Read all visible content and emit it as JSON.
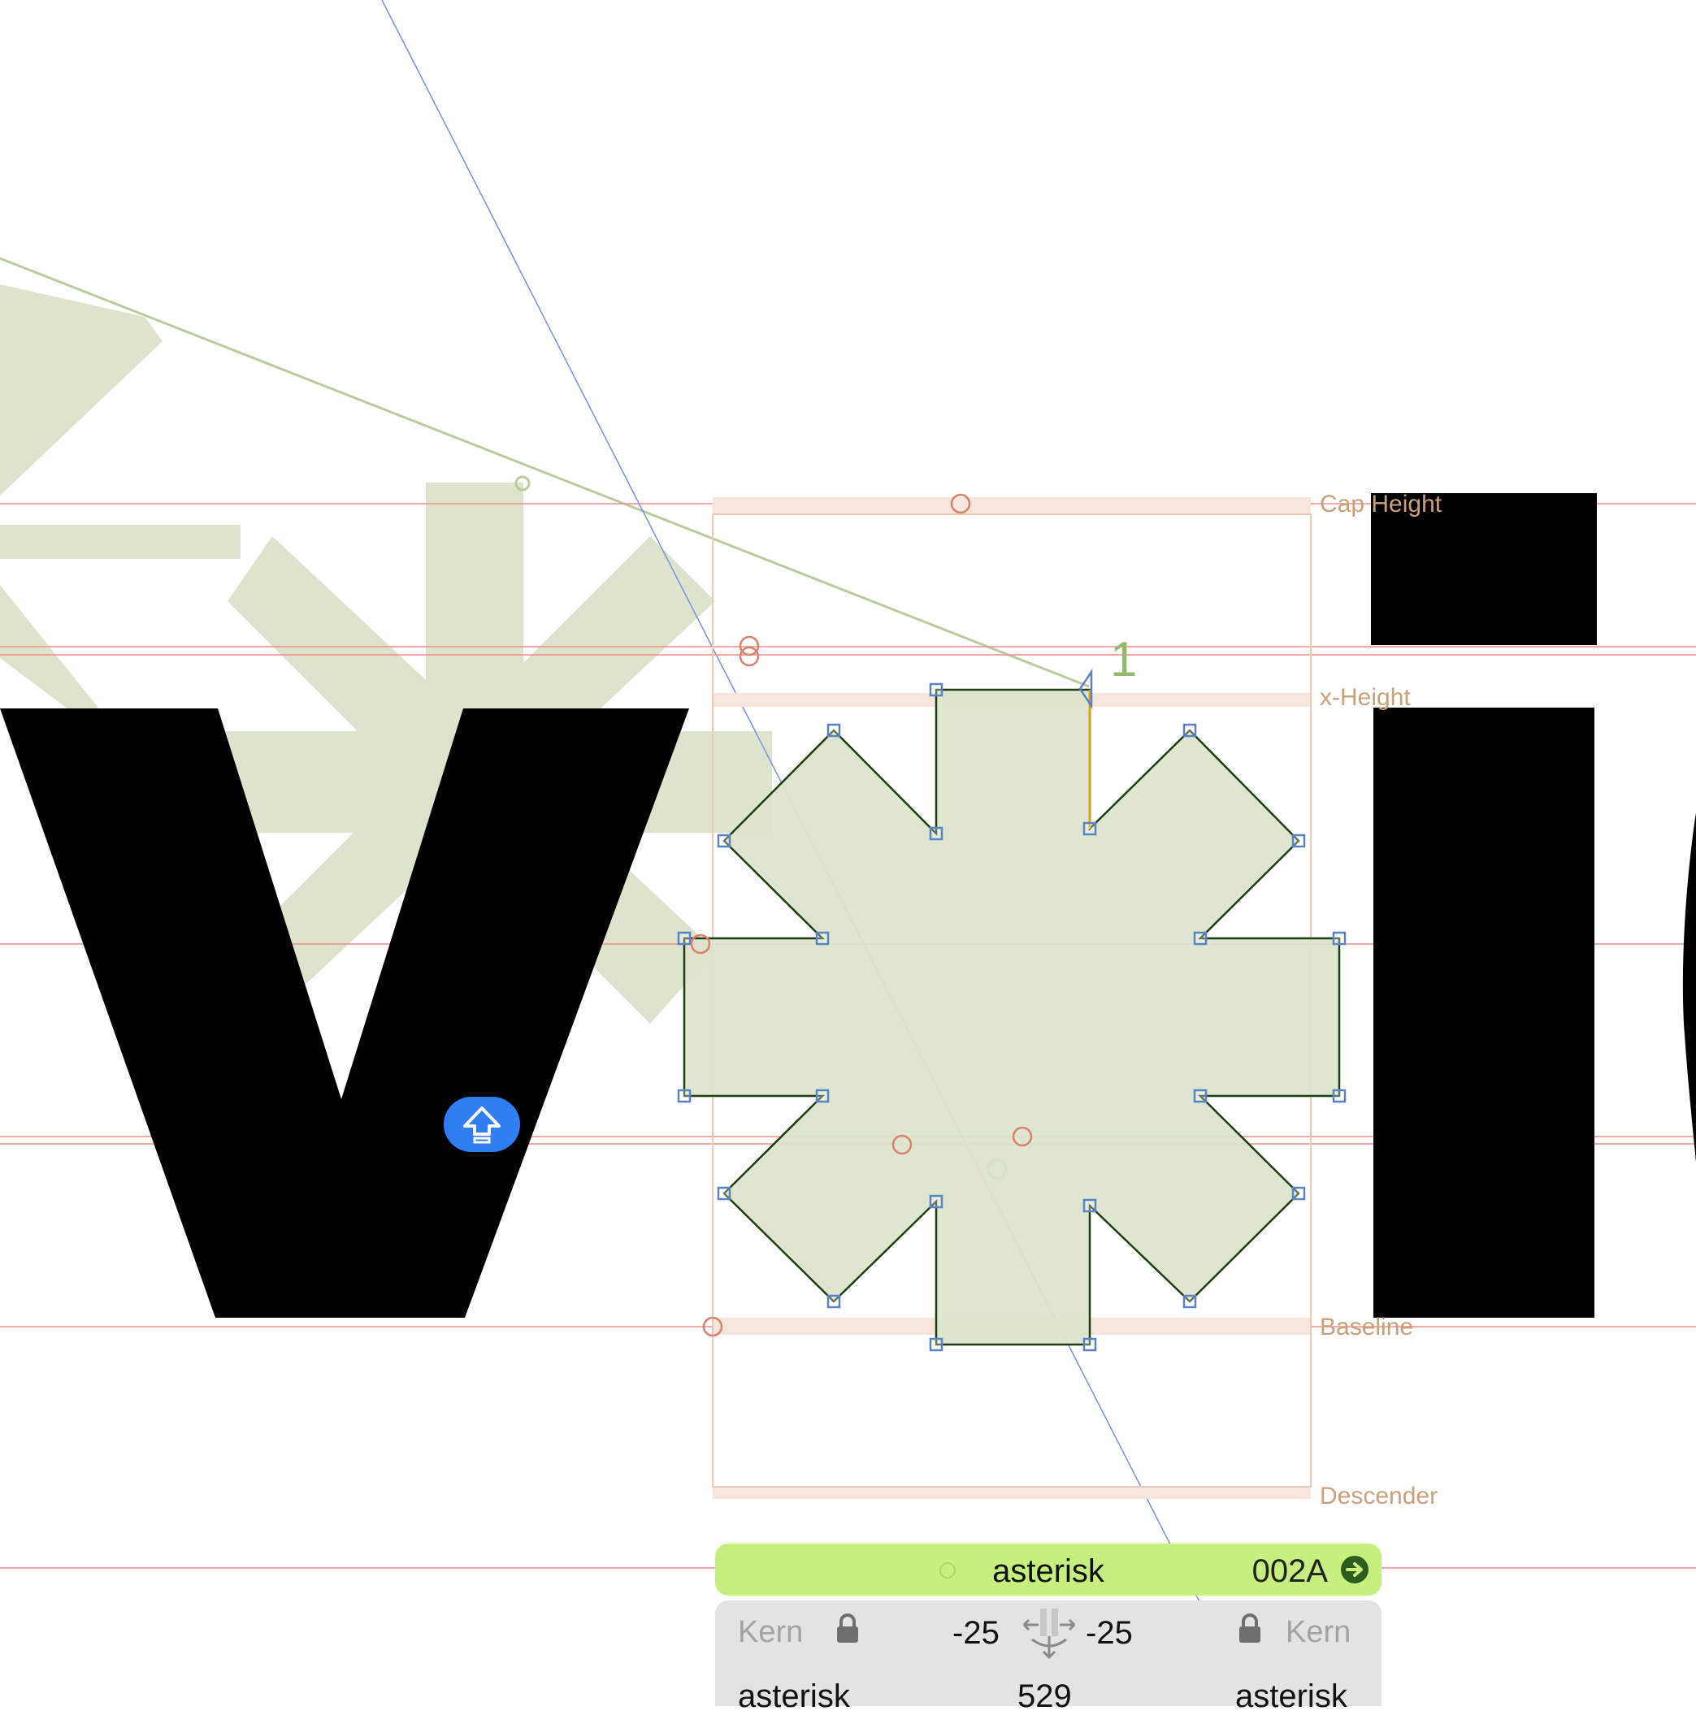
{
  "metrics": {
    "cap_height": "Cap Height",
    "x_height": "x-Height",
    "baseline": "Baseline",
    "descender": "Descender"
  },
  "node_label": "1",
  "glyph": {
    "name": "asterisk",
    "unicode": "002A"
  },
  "kerning": {
    "left_label": "Kern",
    "right_label": "Kern",
    "left_value": "-25",
    "right_value": "-25",
    "left_group": "asterisk",
    "width": "529",
    "right_group": "asterisk"
  },
  "icons": {
    "goto": "arrow-right-circle-icon",
    "lock_left": "lock-icon",
    "lock_right": "lock-icon",
    "kern_link": "kerning-link-icon",
    "shift": "shift-arrow-icon"
  },
  "colors": {
    "glyph_fill": "#dce4cd",
    "background_glyph": "#dce4cd",
    "outline_stroke": "#1f3d12",
    "node": "#5b83c4",
    "metric_line": "#e8908a",
    "metric_label": "#c9a07e",
    "glyph_bar": "#c6ef7f",
    "kern_panel": "#e3e3e3",
    "shift_button": "#2f7ff2",
    "black_glyph": "#000000",
    "measure_line": "#7d8fe0"
  }
}
